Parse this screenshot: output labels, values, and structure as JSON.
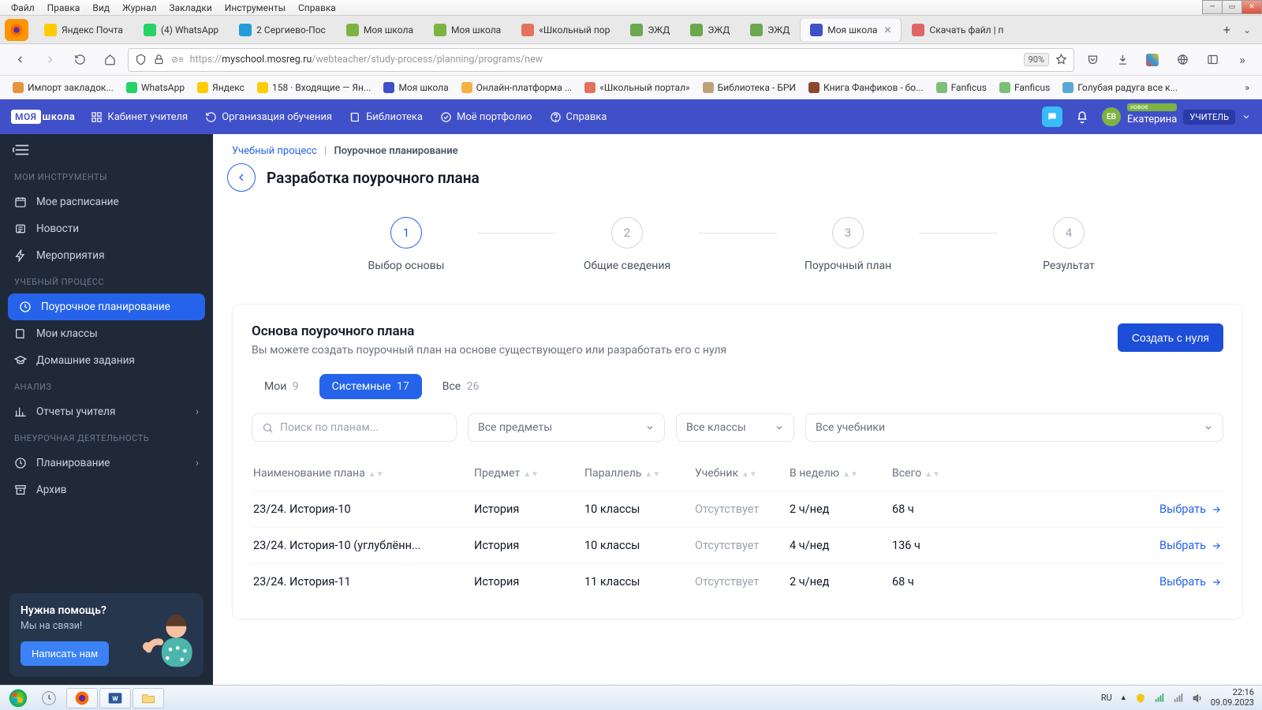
{
  "win_menu": [
    "Файл",
    "Правка",
    "Вид",
    "Журнал",
    "Закладки",
    "Инструменты",
    "Справка"
  ],
  "browser_tabs": [
    {
      "label": "Яндекс Почта",
      "color": "#ffcc00"
    },
    {
      "label": "(4) WhatsApp",
      "color": "#25d366"
    },
    {
      "label": "2 Сергиево-Пос",
      "color": "#229ed9"
    },
    {
      "label": "Моя школа",
      "color": "#7cb342"
    },
    {
      "label": "Моя школа",
      "color": "#7cb342"
    },
    {
      "label": "«Школьный пор",
      "color": "#e2725b"
    },
    {
      "label": "ЭЖД",
      "color": "#6aa84f"
    },
    {
      "label": "ЭЖД",
      "color": "#6aa84f"
    },
    {
      "label": "ЭЖД",
      "color": "#6aa84f"
    },
    {
      "label": "Моя школа",
      "color": "#4050c8",
      "active": true
    },
    {
      "label": "Скачать файл | п",
      "color": "#e06666"
    }
  ],
  "address": {
    "prefix": "https://",
    "host": "myschool.mosreg.ru",
    "path": "/webteacher/study-process/planning/programs/new",
    "zoom": "90%"
  },
  "bookmarks": [
    {
      "label": "Импорт закладок...",
      "color": "#e8943a"
    },
    {
      "label": "WhatsApp",
      "color": "#25d366"
    },
    {
      "label": "Яндекс",
      "color": "#ffcc00"
    },
    {
      "label": "158 · Входящие — Ян...",
      "color": "#ffcc00"
    },
    {
      "label": "Моя школа",
      "color": "#4050c8"
    },
    {
      "label": "Онлайн-платформа ...",
      "color": "#f5b042"
    },
    {
      "label": "«Школьный портал»",
      "color": "#e2725b"
    },
    {
      "label": "Библиотека - БРИ",
      "color": "#bfa27a"
    },
    {
      "label": "Книга Фанфиков - бо...",
      "color": "#8c472f"
    },
    {
      "label": "Fanficus",
      "color": "#7bbf7b"
    },
    {
      "label": "Fanficus",
      "color": "#7bbf7b"
    },
    {
      "label": "Голубая радуга все к...",
      "color": "#5aa7d6"
    }
  ],
  "app_nav": [
    {
      "label": "Кабинет учителя",
      "icon": "grid"
    },
    {
      "label": "Организация обучения",
      "icon": "refresh"
    },
    {
      "label": "Библиотека",
      "icon": "book"
    },
    {
      "label": "Моё портфолио",
      "icon": "check"
    },
    {
      "label": "Справка",
      "icon": "help"
    }
  ],
  "logo": {
    "box": "МОЯ",
    "rest": "школа"
  },
  "user": {
    "new": "новое",
    "name": "Екатерина",
    "role": "УЧИТЕЛЬ",
    "initials": "ЕВ"
  },
  "sidebar": {
    "sections": [
      {
        "title": "МОИ ИНСТРУМЕНТЫ",
        "items": [
          {
            "label": "Мое расписание",
            "icon": "calendar"
          },
          {
            "label": "Новости",
            "icon": "news"
          },
          {
            "label": "Мероприятия",
            "icon": "bolt"
          }
        ]
      },
      {
        "title": "УЧЕБНЫЙ ПРОЦЕСС",
        "items": [
          {
            "label": "Поурочное планирование",
            "icon": "clock",
            "active": true
          },
          {
            "label": "Мои классы",
            "icon": "book"
          },
          {
            "label": "Домашние задания",
            "icon": "cap"
          }
        ]
      },
      {
        "title": "АНАЛИЗ",
        "items": [
          {
            "label": "Отчеты учителя",
            "icon": "chart",
            "chev": true
          }
        ]
      },
      {
        "title": "ВНЕУРОЧНАЯ ДЕЯТЕЛЬНОСТЬ",
        "items": [
          {
            "label": "Планирование",
            "icon": "clock",
            "chev": true
          },
          {
            "label": "Архив",
            "icon": "archive"
          }
        ]
      }
    ],
    "help": {
      "q": "Нужна помощь?",
      "s": "Мы на связи!",
      "btn": "Написать нам"
    }
  },
  "breadcrumb": {
    "a": "Учебный процесс",
    "b": "Поурочное планирование"
  },
  "page_title": "Разработка поурочного плана",
  "steps": [
    "Выбор основы",
    "Общие сведения",
    "Поурочный план",
    "Результат"
  ],
  "card": {
    "title": "Основа поурочного плана",
    "sub": "Вы можете создать поурочный план на основе существующего или разработать его с нуля",
    "create": "Создать с нуля"
  },
  "filter_tabs": [
    {
      "label": "Мои",
      "count": "9"
    },
    {
      "label": "Системные",
      "count": "17",
      "active": true
    },
    {
      "label": "Все",
      "count": "26"
    }
  ],
  "filters": {
    "search_ph": "Поиск по планам...",
    "subject": "Все предметы",
    "class": "Все классы",
    "book": "Все учебники"
  },
  "columns": [
    "Наименование плана",
    "Предмет",
    "Параллель",
    "Учебник",
    "В неделю",
    "Всего",
    ""
  ],
  "rows": [
    {
      "name": "23/24. История-10",
      "subject": "История",
      "parallel": "10 классы",
      "book": "Отсутствует",
      "week": "2 ч/нед",
      "total": "68 ч"
    },
    {
      "name": "23/24. История-10 (углублённ...",
      "subject": "История",
      "parallel": "10 классы",
      "book": "Отсутствует",
      "week": "4 ч/нед",
      "total": "136 ч"
    },
    {
      "name": "23/24. История-11",
      "subject": "История",
      "parallel": "11 классы",
      "book": "Отсутствует",
      "week": "2 ч/нед",
      "total": "68 ч"
    }
  ],
  "select_label": "Выбрать",
  "taskbar": {
    "lang": "RU",
    "time": "22:16",
    "date": "09.09.2023"
  }
}
